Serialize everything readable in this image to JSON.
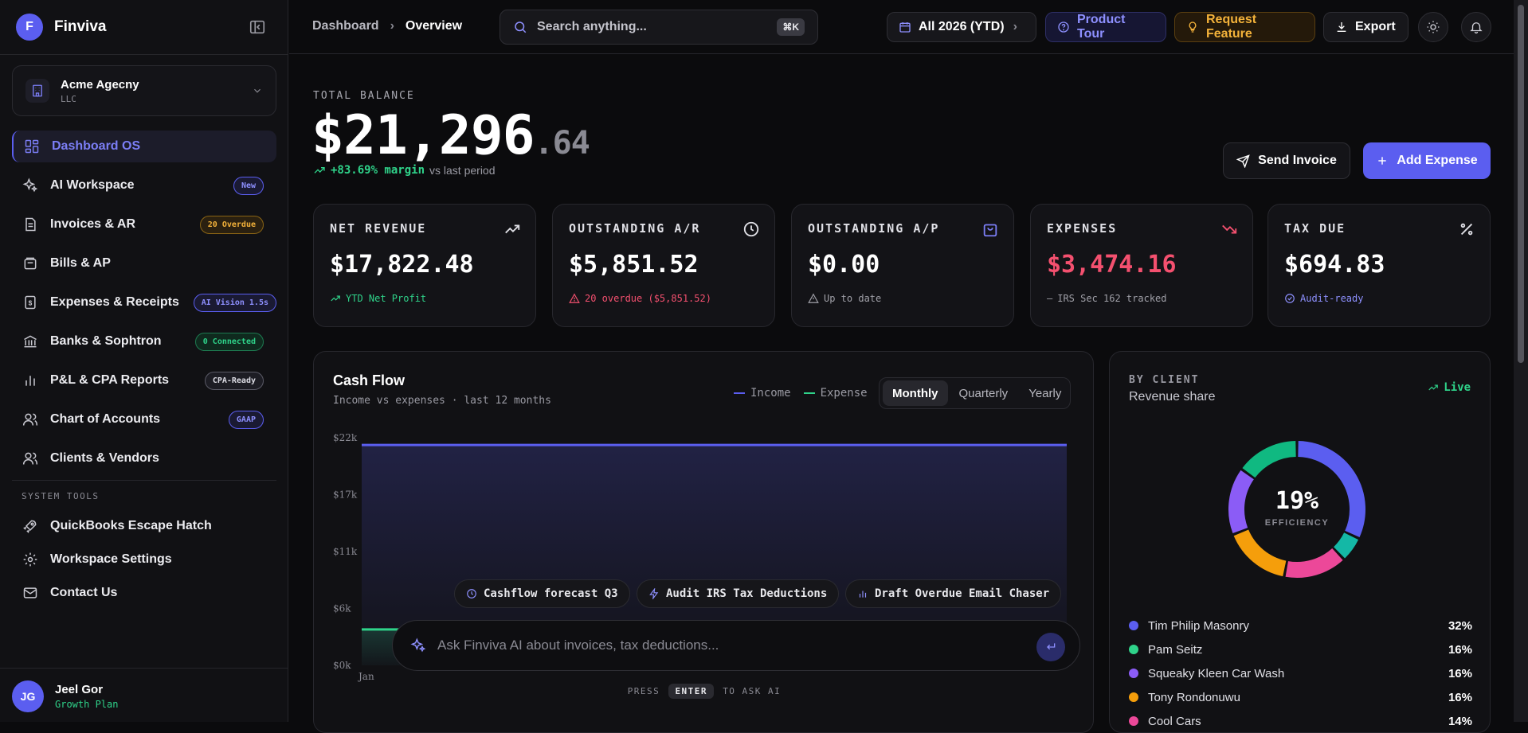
{
  "app": {
    "logo_letter": "F",
    "name": "Finviva"
  },
  "org": {
    "name": "Acme Agecny",
    "type": "LLC"
  },
  "nav": [
    {
      "label": "Dashboard OS",
      "icon": "grid-icon",
      "active": true
    },
    {
      "label": "AI Workspace",
      "icon": "sparkles-icon",
      "badge": "New"
    },
    {
      "label": "Invoices & AR",
      "icon": "document-icon",
      "badge": "20 Overdue"
    },
    {
      "label": "Bills & AP",
      "icon": "wallet-icon"
    },
    {
      "label": "Expenses & Receipts",
      "icon": "receipt-icon",
      "badge": "AI Vision 1.5s"
    },
    {
      "label": "Banks & Sophtron",
      "icon": "bank-icon",
      "badge": "0 Connected"
    },
    {
      "label": "P&L & CPA Reports",
      "icon": "bar-chart-icon",
      "badge": "CPA-Ready"
    },
    {
      "label": "Chart of Accounts",
      "icon": "users-icon",
      "badge": "GAAP"
    },
    {
      "label": "Clients & Vendors",
      "icon": "users-icon"
    }
  ],
  "system_tools": {
    "title": "SYSTEM TOOLS",
    "items": [
      {
        "label": "QuickBooks Escape Hatch",
        "icon": "rocket-icon"
      },
      {
        "label": "Workspace Settings",
        "icon": "gear-icon"
      },
      {
        "label": "Contact Us",
        "icon": "mail-icon"
      }
    ]
  },
  "user": {
    "initials": "JG",
    "name": "Jeel Gor",
    "plan": "Growth Plan"
  },
  "header": {
    "breadcrumb": [
      "Dashboard",
      "Overview"
    ],
    "search_placeholder": "Search anything...",
    "search_shortcut": "⌘K",
    "period": "All 2026 (YTD)",
    "tour": "Product Tour",
    "feature": "Request Feature",
    "export": "Export"
  },
  "balance": {
    "label": "TOTAL BALANCE",
    "whole": "$21,296",
    "cents": ".64",
    "delta": "+83.69% margin",
    "delta_note": "vs last period"
  },
  "actions": {
    "send_invoice": "Send Invoice",
    "add_expense": "Add Expense"
  },
  "kpis": [
    {
      "label": "NET REVENUE",
      "icon": "trending-up-icon",
      "value": "$17,822.48",
      "sub": "YTD Net Profit",
      "tone": "green"
    },
    {
      "label": "OUTSTANDING A/R",
      "icon": "clock-icon",
      "value": "$5,851.52",
      "sub": "20 overdue ($5,851.52)",
      "tone": "red"
    },
    {
      "label": "OUTSTANDING A/P",
      "icon": "bag-icon",
      "value": "$0.00",
      "sub": "Up to date",
      "tone": "muted"
    },
    {
      "label": "EXPENSES",
      "icon": "trending-down-icon",
      "value": "$3,474.16",
      "sub": "IRS Sec 162 tracked",
      "tone": "muted"
    },
    {
      "label": "TAX DUE",
      "icon": "percent-icon",
      "value": "$694.83",
      "sub": "Audit-ready",
      "tone": "blue"
    }
  ],
  "cashflow": {
    "title": "Cash Flow",
    "subtitle": "Income vs expenses · last 12 months",
    "legend": [
      "Income",
      "Expense"
    ],
    "periods": [
      "Monthly",
      "Quarterly",
      "Yearly"
    ],
    "active_period": "Monthly",
    "quick_prompts": [
      "Cashflow forecast Q3",
      "Audit IRS Tax Deductions",
      "Draft Overdue Email Chaser"
    ],
    "ask_placeholder": "Ask Finviva AI about invoices, tax deductions...",
    "press_hint": [
      "PRESS",
      "ENTER",
      "TO ASK AI"
    ]
  },
  "chart_data": {
    "type": "area",
    "y_ticks": [
      "$22k",
      "$17k",
      "$11k",
      "$6k",
      "$0k"
    ],
    "ylim": [
      0,
      22000
    ],
    "x": [
      "Jan"
    ],
    "series": [
      {
        "name": "Income",
        "values": [
          21296
        ],
        "color": "#5b5ef0"
      },
      {
        "name": "Expense",
        "values": [
          3474
        ],
        "color": "#2fd38a"
      }
    ]
  },
  "by_client": {
    "title": "BY CLIENT",
    "subtitle": "Revenue share",
    "live": "Live",
    "center_value": "19%",
    "center_label": "EFFICIENCY",
    "clients": [
      {
        "name": "Tim Philip Masonry",
        "pct": "32%",
        "color": "#5b5ef0"
      },
      {
        "name": "Pam Seitz",
        "pct": "16%",
        "color": "#2fd38a"
      },
      {
        "name": "Squeaky Kleen Car Wash",
        "pct": "16%",
        "color": "#8b5cf6"
      },
      {
        "name": "Tony Rondonuwu",
        "pct": "16%",
        "color": "#f59e0b"
      },
      {
        "name": "Cool Cars",
        "pct": "14%",
        "color": "#ec4899"
      }
    ],
    "donut": [
      {
        "value": 32,
        "color": "#5b5ef0"
      },
      {
        "value": 6,
        "color": "#14b8a6"
      },
      {
        "value": 15,
        "color": "#ec4899"
      },
      {
        "value": 16,
        "color": "#f59e0b"
      },
      {
        "value": 16,
        "color": "#8b5cf6"
      },
      {
        "value": 15,
        "color": "#10b981"
      }
    ]
  }
}
